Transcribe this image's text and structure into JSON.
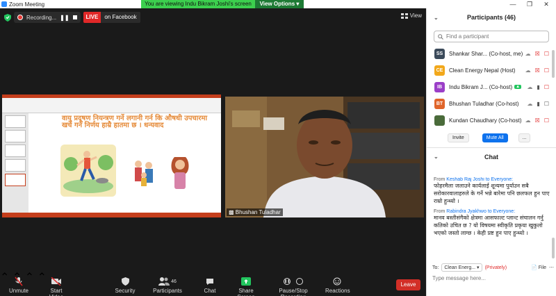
{
  "window": {
    "title": "Zoom Meeting"
  },
  "banner": {
    "text": "You are viewing Indu Bikram Joshi's screen",
    "view_options": "View Options"
  },
  "topbar": {
    "recording_label": "Recording...",
    "live_label": "LIVE",
    "live_target": "on Facebook",
    "view_label": "View"
  },
  "shared_slide": {
    "text": "वायु प्रदूषण नियन्त्रण गर्ने लगानी गर्न कि औषधी उपचारमा खर्च गर्न निर्णय हाम्रै हातमा छ । धन्यवाद"
  },
  "video": {
    "name": "Bhushan Tuladhar"
  },
  "toolbar": {
    "unmute": "Unmute",
    "start_video": "Start Video",
    "security": "Security",
    "participants": "Participants",
    "participants_count": "46",
    "chat": "Chat",
    "share_screen": "Share Screen",
    "record": "Pause/Stop Recording",
    "reactions": "Reactions",
    "leave": "Leave"
  },
  "participants_panel": {
    "title": "Participants (46)",
    "search_placeholder": "Find a participant",
    "people": [
      {
        "initials": "SS",
        "name": "Shankar Shar... (Co-host, me)",
        "color": "#3b4a5a"
      },
      {
        "initials": "CE",
        "name": "Clean Energy Nepal (Host)",
        "color": "#f2a81b"
      },
      {
        "initials": "IB",
        "name": "Indu Bikram J... (Co-host)",
        "color": "#9b3fc8"
      },
      {
        "initials": "BT",
        "name": "Bhushan Tuladhar (Co-host)",
        "color": "#e0652a"
      },
      {
        "initials": "",
        "name": "Kundan Chaudhary (Co-host)",
        "color": "#4a6b3a"
      }
    ],
    "invite": "Invite",
    "mute_all": "Mute All",
    "more": "..."
  },
  "chat_panel": {
    "title": "Chat",
    "messages": [
      {
        "from_prefix": "From",
        "sender": "Keshab Raj Joshi",
        "to": "to Everyone:",
        "text": "फोहरमैला जलाउने कार्यलाई शून्यमा पुर्याउन सबै सरोकारवालाहरुले के गर्ने भन्ने बारेमा पनि छलफल हुन पाए राम्रो हुन्थ्यो ।"
      },
      {
        "from_prefix": "From",
        "sender": "Rabindra Jyakhwo",
        "to": "to Everyone:",
        "text": "मानव बस्तीसंगैको क्षेत्रमा आसफाल्ट प्लान्ट संचालन गर्नु कतिको उचित छ ? यो विषयमा स्वीकृति प्रकृया खुकुलो भएको जस्तो लाग्छ । केही प्रष्ट हुन पाए हुन्थ्यो ।"
      }
    ],
    "to_label": "To:",
    "to_value": "Clean Energ...",
    "private": "(Privately)",
    "file": "File",
    "input_placeholder": "Type message here..."
  }
}
